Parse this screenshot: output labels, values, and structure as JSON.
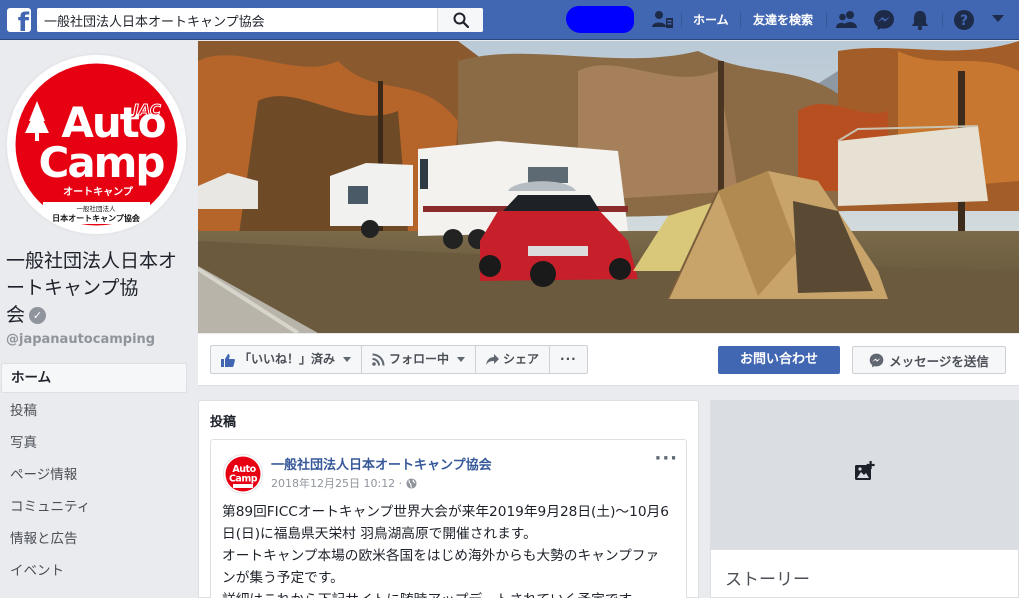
{
  "topbar": {
    "search_value": "一般社団法人日本オートキャンプ協会",
    "home_label": "ホーム",
    "find_friends_label": "友達を検索",
    "colors": {
      "bar": "#4267b2",
      "profile_redaction": "#0000ff"
    },
    "icons": [
      "facebook-logo-icon",
      "search-icon",
      "friend-requests-icon",
      "people-icon",
      "messenger-icon",
      "notifications-bell-icon",
      "help-icon",
      "account-caret-icon"
    ]
  },
  "page": {
    "name_lines": [
      "一般社団法人日本オ",
      "ートキャンプ協",
      "会"
    ],
    "handle": "@japanautocamping",
    "logo": {
      "wordmark_top": "Auto",
      "wordmark_bottom": "Camp",
      "badge": "JAC",
      "subtitle": "オートキャンプ",
      "caption_small": "一般社団法人",
      "caption_org": "日本オートキャンプ協会",
      "colors": {
        "red": "#e60012",
        "white": "#ffffff"
      }
    }
  },
  "side_nav": {
    "items": [
      {
        "label": "ホーム",
        "active": true
      },
      {
        "label": "投稿",
        "active": false
      },
      {
        "label": "写真",
        "active": false
      },
      {
        "label": "ページ情報",
        "active": false
      },
      {
        "label": "コミュニティ",
        "active": false
      },
      {
        "label": "情報と広告",
        "active": false
      },
      {
        "label": "イベント",
        "active": false
      }
    ]
  },
  "actions": {
    "liked_label": "「いいね！」済み",
    "following_label": "フォロー中",
    "share_label": "シェア",
    "more_label": "···",
    "contact_label": "お問い合わせ",
    "message_label": "メッセージを送信"
  },
  "posts": {
    "heading": "投稿",
    "items": [
      {
        "author": "一般社団法人日本オートキャンプ協会",
        "date": "2018年12月25日 10:12 ·",
        "privacy_icon": "globe-icon",
        "menu_label": "···",
        "body_lines": [
          "第89回FICCオートキャンプ世界大会が来年2019年9月28日(土)～10月6",
          "日(日)に福島県天栄村 羽鳥湖高原で開催されます。",
          "オートキャンプ本場の欧米各国をはじめ海外からも大勢のキャンプファ",
          "ンが集う予定です。",
          "詳細はこれから下記サイトに随時アップデートされていく予定です。"
        ]
      }
    ]
  },
  "stories": {
    "title": "ストーリー",
    "icon": "add-photo-icon"
  }
}
